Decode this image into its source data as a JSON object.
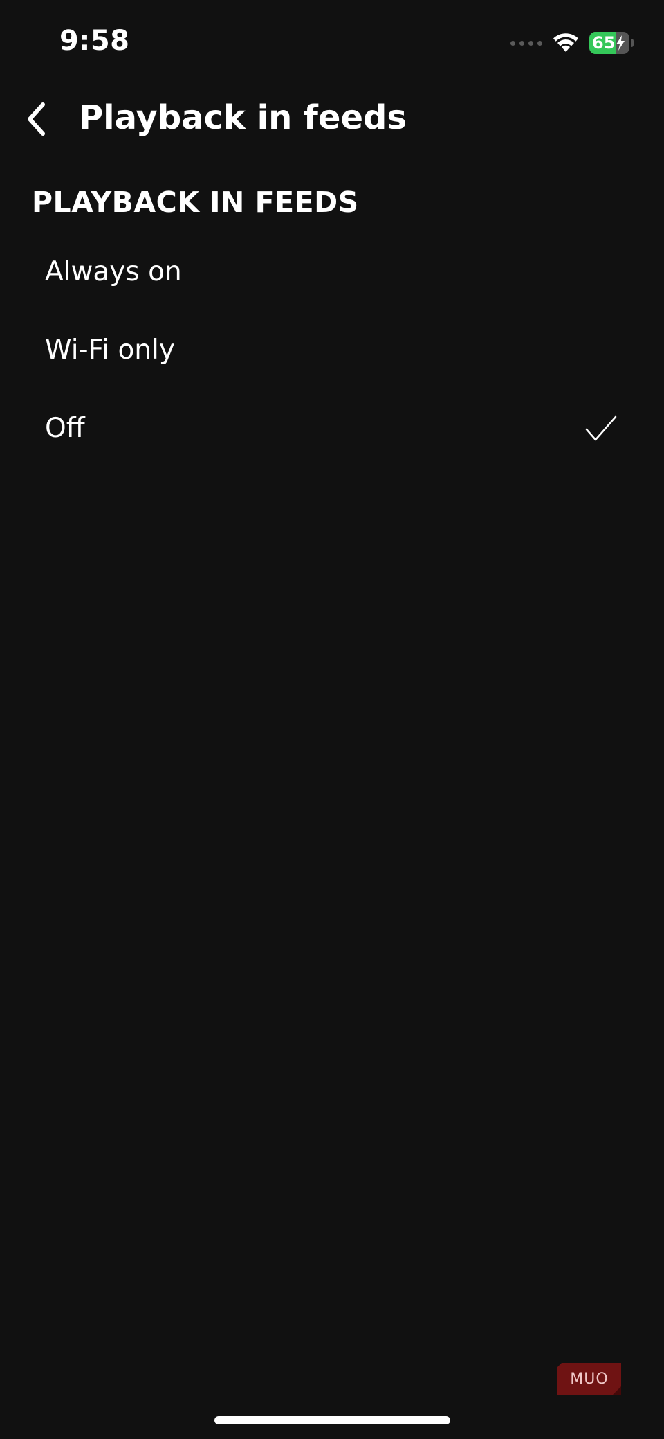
{
  "status_bar": {
    "time": "9:58",
    "battery_level": "65",
    "icons": [
      "cellular-signal-icon",
      "wifi-icon",
      "battery-charging-icon"
    ]
  },
  "header": {
    "title": "Playback in feeds",
    "back_icon": "chevron-left-icon"
  },
  "section": {
    "title": "PLAYBACK IN FEEDS",
    "options": [
      {
        "label": "Always on",
        "selected": false
      },
      {
        "label": "Wi-Fi only",
        "selected": false
      },
      {
        "label": "Off",
        "selected": true
      }
    ]
  },
  "watermark": {
    "text": "MUO",
    "color": "#7a1414"
  },
  "colors": {
    "background": "#111111",
    "text": "#ffffff",
    "battery_green": "#34c759"
  }
}
